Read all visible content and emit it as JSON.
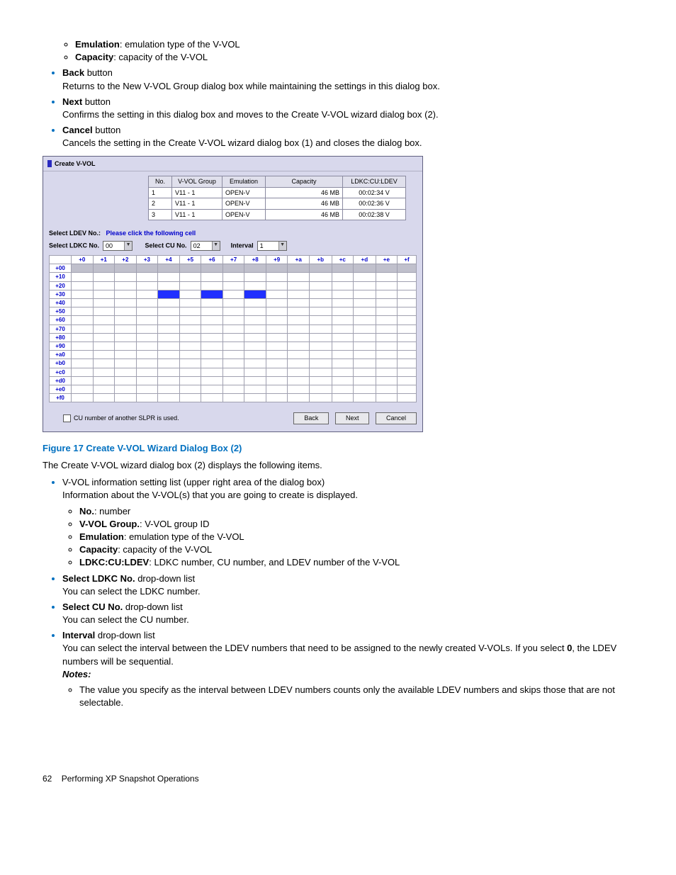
{
  "top_list": {
    "emulation": {
      "b": "Emulation",
      "t": ":  emulation type of the V-VOL"
    },
    "capacity": {
      "b": "Capacity",
      "t": ":  capacity of the V-VOL"
    },
    "back": {
      "b": "Back",
      "t": " button",
      "d": "Returns to the New V-VOL Group dialog box while maintaining the settings in this dialog box."
    },
    "next": {
      "b": "Next",
      "t": " button",
      "d": "Confirms the setting in this dialog box and moves to the Create V-VOL wizard dialog box (2)."
    },
    "cancel": {
      "b": "Cancel",
      "t": " button",
      "d": "Cancels the setting in the Create V-VOL wizard dialog box (1) and closes the dialog box."
    }
  },
  "shot": {
    "title": "Create V-VOL",
    "th": [
      "No.",
      "V-VOL Group",
      "Emulation",
      "Capacity",
      "LDKC:CU:LDEV"
    ],
    "rows": [
      [
        "1",
        "V11 - 1",
        "OPEN-V",
        "46 MB",
        "00:02:34 V"
      ],
      [
        "2",
        "V11 - 1",
        "OPEN-V",
        "46 MB",
        "00:02:36 V"
      ],
      [
        "3",
        "V11 - 1",
        "OPEN-V",
        "46 MB",
        "00:02:38 V"
      ]
    ],
    "instr_label": "Select LDEV No.:",
    "instr": "Please click the following cell",
    "sel_ldkc_lbl": "Select LDKC No.",
    "sel_ldkc_v": "00",
    "sel_cu_lbl": "Select CU No.",
    "sel_cu_v": "02",
    "interval_lbl": "Interval",
    "interval_v": "1",
    "cols": [
      "+0",
      "+1",
      "+2",
      "+3",
      "+4",
      "+5",
      "+6",
      "+7",
      "+8",
      "+9",
      "+a",
      "+b",
      "+c",
      "+d",
      "+e",
      "+f"
    ],
    "rowsh": [
      "+00",
      "+10",
      "+20",
      "+30",
      "+40",
      "+50",
      "+60",
      "+70",
      "+80",
      "+90",
      "+a0",
      "+b0",
      "+c0",
      "+d0",
      "+e0",
      "+f0"
    ],
    "sel_cells": {
      "+30": [
        "+4",
        "+6",
        "+8"
      ]
    },
    "chk_lbl": "CU number of another SLPR is used.",
    "btn_back": "Back",
    "btn_next": "Next",
    "btn_cancel": "Cancel"
  },
  "fig_caption": "Figure 17 Create V-VOL Wizard Dialog Box (2)",
  "para_after_fig": "The Create V-VOL wizard dialog box (2) displays the following items.",
  "bot_list": {
    "vvol_info": {
      "t": "V-VOL information setting list (upper right area of the dialog box)",
      "d": "Information about the V-VOL(s) that you are going to create is displayed."
    },
    "no": {
      "b": "No.",
      "t": ":  number"
    },
    "vvolg": {
      "b": "V-VOL Group.",
      "t": ":  V-VOL group ID"
    },
    "emu": {
      "b": "Emulation",
      "t": ":  emulation type of the V-VOL"
    },
    "cap": {
      "b": "Capacity",
      "t": ":  capacity of the V-VOL"
    },
    "ldkc": {
      "b": "LDKC:CU:LDEV",
      "t": ": LDKC number, CU number, and LDEV number of the V-VOL"
    },
    "sel_ldkc": {
      "b": "Select LDKC No.",
      "t": "  drop-down list",
      "d": "You can select the LDKC number."
    },
    "sel_cu": {
      "b": "Select CU No.",
      "t": "  drop-down list",
      "d": "You can select the CU number."
    },
    "interval_b": "Interval",
    "interval_t": " drop-down list",
    "interval_d1": "You can select the interval between the LDEV numbers that need to be assigned to the newly created V-VOLs.  If you select ",
    "interval_zero": "0",
    "interval_d2": ", the LDEV numbers will be sequential.",
    "notes": "Notes:",
    "note1": "The value you specify as the interval between LDEV numbers counts only the available LDEV numbers and skips those that are not selectable."
  },
  "footer": {
    "page": "62",
    "title": "Performing XP Snapshot Operations"
  }
}
